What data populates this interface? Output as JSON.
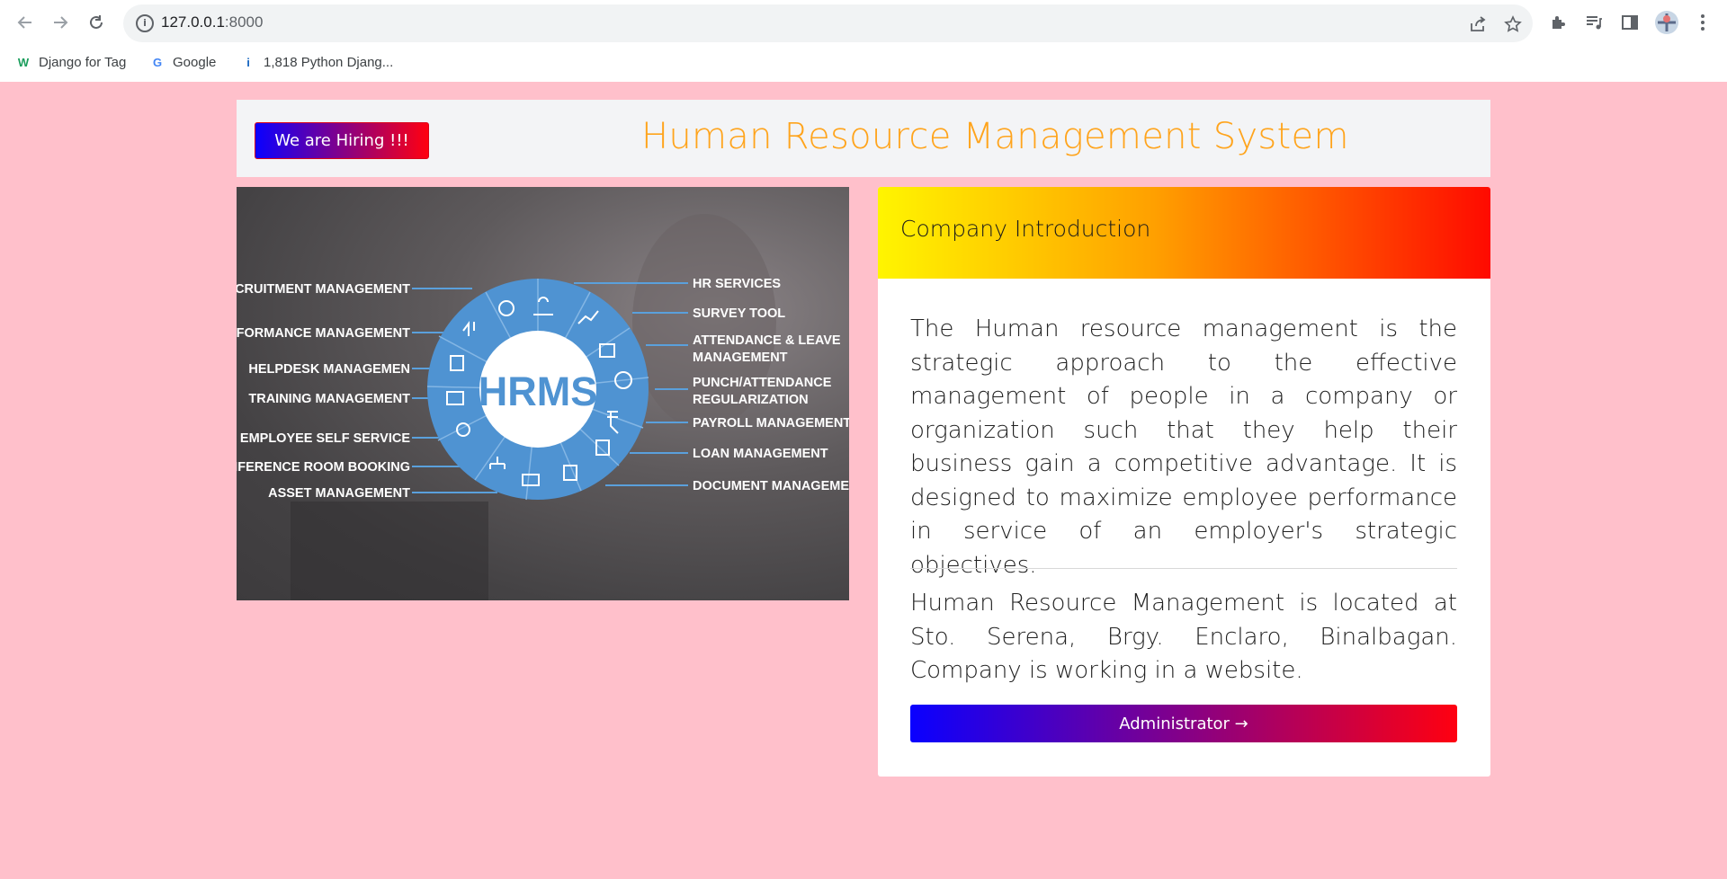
{
  "browser": {
    "url_host": "127.0.0.1",
    "url_port": ":8000",
    "bookmarks": [
      {
        "label": "Django for Tag",
        "icon": "w-site-icon",
        "color": "#1a9d5c"
      },
      {
        "label": "Google",
        "icon": "google-icon",
        "color": "#4285f4"
      },
      {
        "label": "1,818 Python Djang...",
        "icon": "info-site-icon",
        "color": "#1565c0"
      }
    ]
  },
  "header": {
    "hiring_label": "We are Hiring !!!",
    "title": "Human Resource Management System"
  },
  "hero": {
    "center_label": "HRMS",
    "left_modules": [
      "RECRUITMENT MANAGEMENT",
      "PERFORMANCE MANAGEMENT",
      "HELPDESK MANAGEMEN",
      "TRAINING MANAGEMENT",
      "EMPLOYEE SELF SERVICE",
      "CONFERENCE ROOM BOOKING",
      "ASSET MANAGEMENT"
    ],
    "right_modules": [
      "HR SERVICES",
      "SURVEY TOOL",
      "ATTENDANCE & LEAVE",
      "MANAGEMENT",
      "PUNCH/ATTENDANCE",
      "REGULARIZATION",
      "PAYROLL MANAGEMENT",
      "LOAN MANAGEMENT",
      "DOCUMENT MANAGEMENT"
    ]
  },
  "intro_card": {
    "title": "Company Introduction",
    "paragraph": "The Human resource management is the strategic approach to the effective management of people in a company or organization such that they help their business gain a competitive advantage. It is designed to maximize employee performance in service of an employer's strategic objectives.",
    "location": "Human Resource Management is located at Sto. Serena, Brgy. Enclaro, Binalbagan. Company is working in a website.",
    "admin_button": "Administrator →"
  },
  "colors": {
    "page_bg": "#ffc0cb",
    "title_orange": "#ffa41c",
    "wheel_blue": "#4f93d2",
    "button_gradient_start": "#0a00ff",
    "button_gradient_end": "#ff0010"
  }
}
